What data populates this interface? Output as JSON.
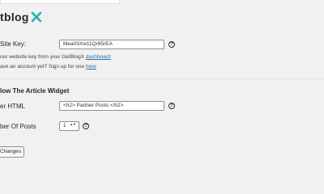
{
  "header": {
    "logo_text": "tblog",
    "logo_mark": "X",
    "accent": "#19b5a5"
  },
  "fields": {
    "site_key": {
      "label": "Site Key:",
      "value": "Mea03Xw11Qr85rEA",
      "help_icon": "question-circle-icon",
      "help_symbol": "?"
    },
    "site_key_desc_prefix": "our website key from your GetBlogX ",
    "site_key_desc_link": "dashboard",
    "signup_desc_prefix": "ave an account yet? Sign up for one ",
    "signup_desc_link": "here"
  },
  "widget": {
    "section_title": "low The Article Widget",
    "header_html_label": "er HTML",
    "header_html_value": "<h2> Partner Posts </h2>",
    "posts_label": "ber Of Posts",
    "posts_value": "1",
    "posts_arrows": "▲▼",
    "help_symbol": "?"
  },
  "save_button": {
    "label": "Changes"
  }
}
